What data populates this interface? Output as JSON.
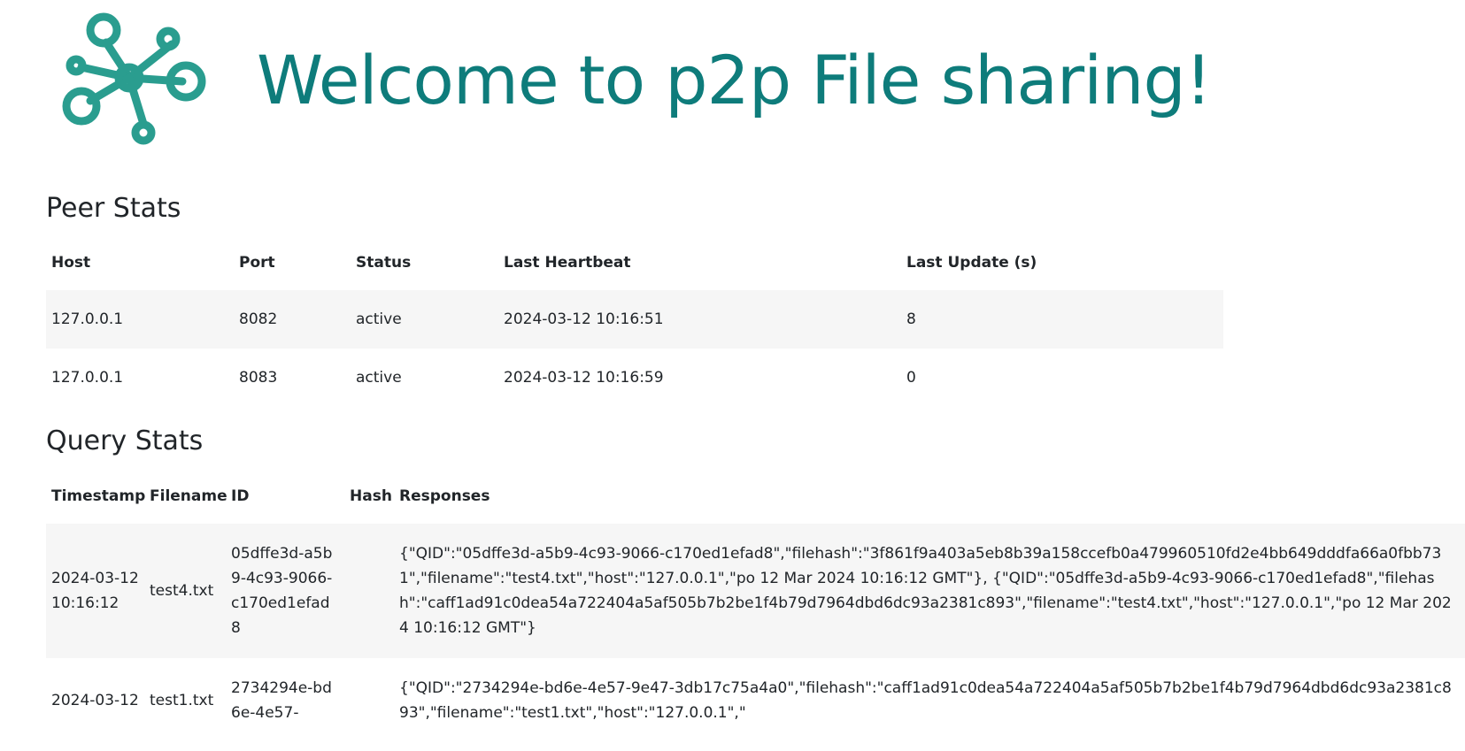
{
  "header": {
    "title": "Welcome to p2p File sharing!",
    "logo_icon": "network-nodes-icon",
    "accent_color": "#2a9d8f"
  },
  "peer_stats": {
    "title": "Peer Stats",
    "columns": [
      "Host",
      "Port",
      "Status",
      "Last Heartbeat",
      "Last Update (s)"
    ],
    "rows": [
      {
        "host": "127.0.0.1",
        "port": "8082",
        "status": "active",
        "last_heartbeat": "2024-03-12 10:16:51",
        "last_update": "8"
      },
      {
        "host": "127.0.0.1",
        "port": "8083",
        "status": "active",
        "last_heartbeat": "2024-03-12 10:16:59",
        "last_update": "0"
      }
    ]
  },
  "query_stats": {
    "title": "Query Stats",
    "columns": [
      "Timestamp",
      "Filename",
      "ID",
      "Hash",
      "Responses"
    ],
    "rows": [
      {
        "timestamp": "2024-03-12 10:16:12",
        "filename": "test4.txt",
        "id": "05dffe3d-a5b9-4c93-9066-c170ed1efad8",
        "hash": "",
        "responses": "{\"QID\":\"05dffe3d-a5b9-4c93-9066-c170ed1efad8\",\"filehash\":\"3f861f9a403a5eb8b39a158ccefb0a479960510fd2e4bb649dddfa66a0fbb731\",\"filename\":\"test4.txt\",\"host\":\"127.0.0.1\",\"po 12 Mar 2024 10:16:12 GMT\"}, {\"QID\":\"05dffe3d-a5b9-4c93-9066-c170ed1efad8\",\"filehash\":\"caff1ad91c0dea54a722404a5af505b7b2be1f4b79d7964dbd6dc93a2381c893\",\"filename\":\"test4.txt\",\"host\":\"127.0.0.1\",\"po 12 Mar 2024 10:16:12 GMT\"}"
      },
      {
        "timestamp": "2024-03-12",
        "filename": "test1.txt",
        "id": "2734294e-bd6e-4e57-",
        "hash": "",
        "responses": "{\"QID\":\"2734294e-bd6e-4e57-9e47-3db17c75a4a0\",\"filehash\":\"caff1ad91c0dea54a722404a5af505b7b2be1f4b79d7964dbd6dc93a2381c893\",\"filename\":\"test1.txt\",\"host\":\"127.0.0.1\",\""
      }
    ]
  }
}
